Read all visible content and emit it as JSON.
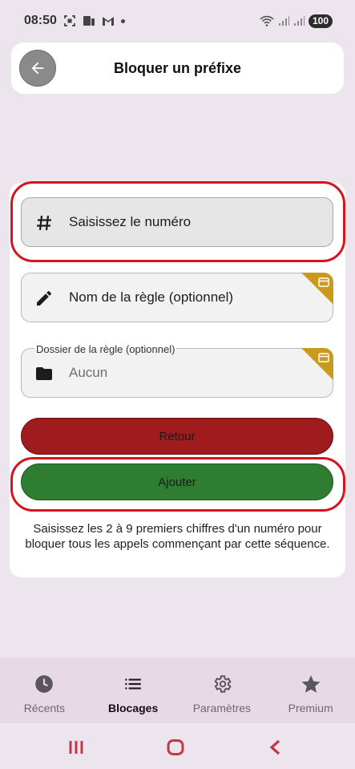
{
  "status_bar": {
    "time": "08:50",
    "battery": "100"
  },
  "header": {
    "title": "Bloquer un préfixe",
    "back_icon": "arrow-left-icon"
  },
  "form": {
    "number_field": {
      "placeholder": "Saisissez le numéro",
      "icon": "hash-icon"
    },
    "rule_name_field": {
      "placeholder": "Nom de la règle (optionnel)",
      "icon": "pencil-icon",
      "badge_icon": "premium-card-icon"
    },
    "rule_folder_field": {
      "label": "Dossier de la règle (optionnel)",
      "value": "Aucun",
      "icon": "folder-icon",
      "badge_icon": "premium-card-icon"
    },
    "back_button_label": "Retour",
    "add_button_label": "Ajouter",
    "help_text": "Saisissez les 2 à 9 premiers chiffres d'un numéro pour bloquer tous les appels commençant par cette séquence."
  },
  "colors": {
    "retour": "#a01b1d",
    "ajouter": "#2e7d31",
    "premium_badge": "#c99a1e",
    "highlight": "#d6141e"
  },
  "bottom_nav": {
    "items": [
      {
        "label": "Récents",
        "icon": "clock-icon",
        "active": false
      },
      {
        "label": "Blocages",
        "icon": "list-icon",
        "active": true
      },
      {
        "label": "Paramètres",
        "icon": "gear-icon",
        "active": false
      },
      {
        "label": "Premium",
        "icon": "star-icon",
        "active": false
      }
    ]
  }
}
